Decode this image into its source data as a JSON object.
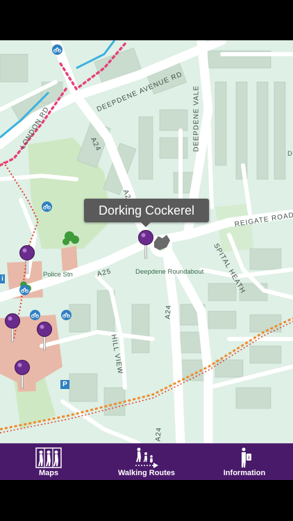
{
  "map": {
    "callout_title": "Dorking Cockerel",
    "road_labels": {
      "deepdene_avenue_rd": "DEEPDENE AVENUE RD",
      "deepdene_vale": "DEEPDENE VALE",
      "london_rd": "LONDON RD",
      "a24_north": "A24",
      "a24_mid": "A24",
      "a24_south": "A24",
      "a24_bottom": "A24",
      "reigate_road": "REIGATE ROAD",
      "spital_heath": "SPITAL HEATH",
      "a25": "A25",
      "hill_view": "HILL VIEW"
    },
    "place_labels": {
      "police_stn": "Police Stn",
      "deepdene_roundabout": "Deepdene Roundabout",
      "edge_d": "D"
    },
    "parking_symbol": "P",
    "info_symbol": "i",
    "pins": [
      {
        "name": "Dorking Cockerel",
        "selected": true
      },
      {
        "name": "pin-police-stn",
        "selected": false
      },
      {
        "name": "pin-left-1",
        "selected": false
      },
      {
        "name": "pin-left-2",
        "selected": false
      },
      {
        "name": "pin-left-3",
        "selected": false
      }
    ],
    "colors": {
      "land": "#dff0e6",
      "road": "#ffffff",
      "building": "#c9dccd",
      "pin": "#6a2c8c",
      "route_pink": "#e8407a",
      "route_red": "#e03a2a",
      "route_orange": "#f08a2a",
      "cycle_blue": "#2f7fc1",
      "park": "#cfe8c4"
    }
  },
  "tabbar": {
    "tabs": [
      {
        "label": "Maps",
        "icon": "walkers-icon"
      },
      {
        "label": "Walking Routes",
        "icon": "walking-route-icon"
      },
      {
        "label": "Information",
        "icon": "information-icon"
      }
    ],
    "color": "#4a1a6a"
  }
}
